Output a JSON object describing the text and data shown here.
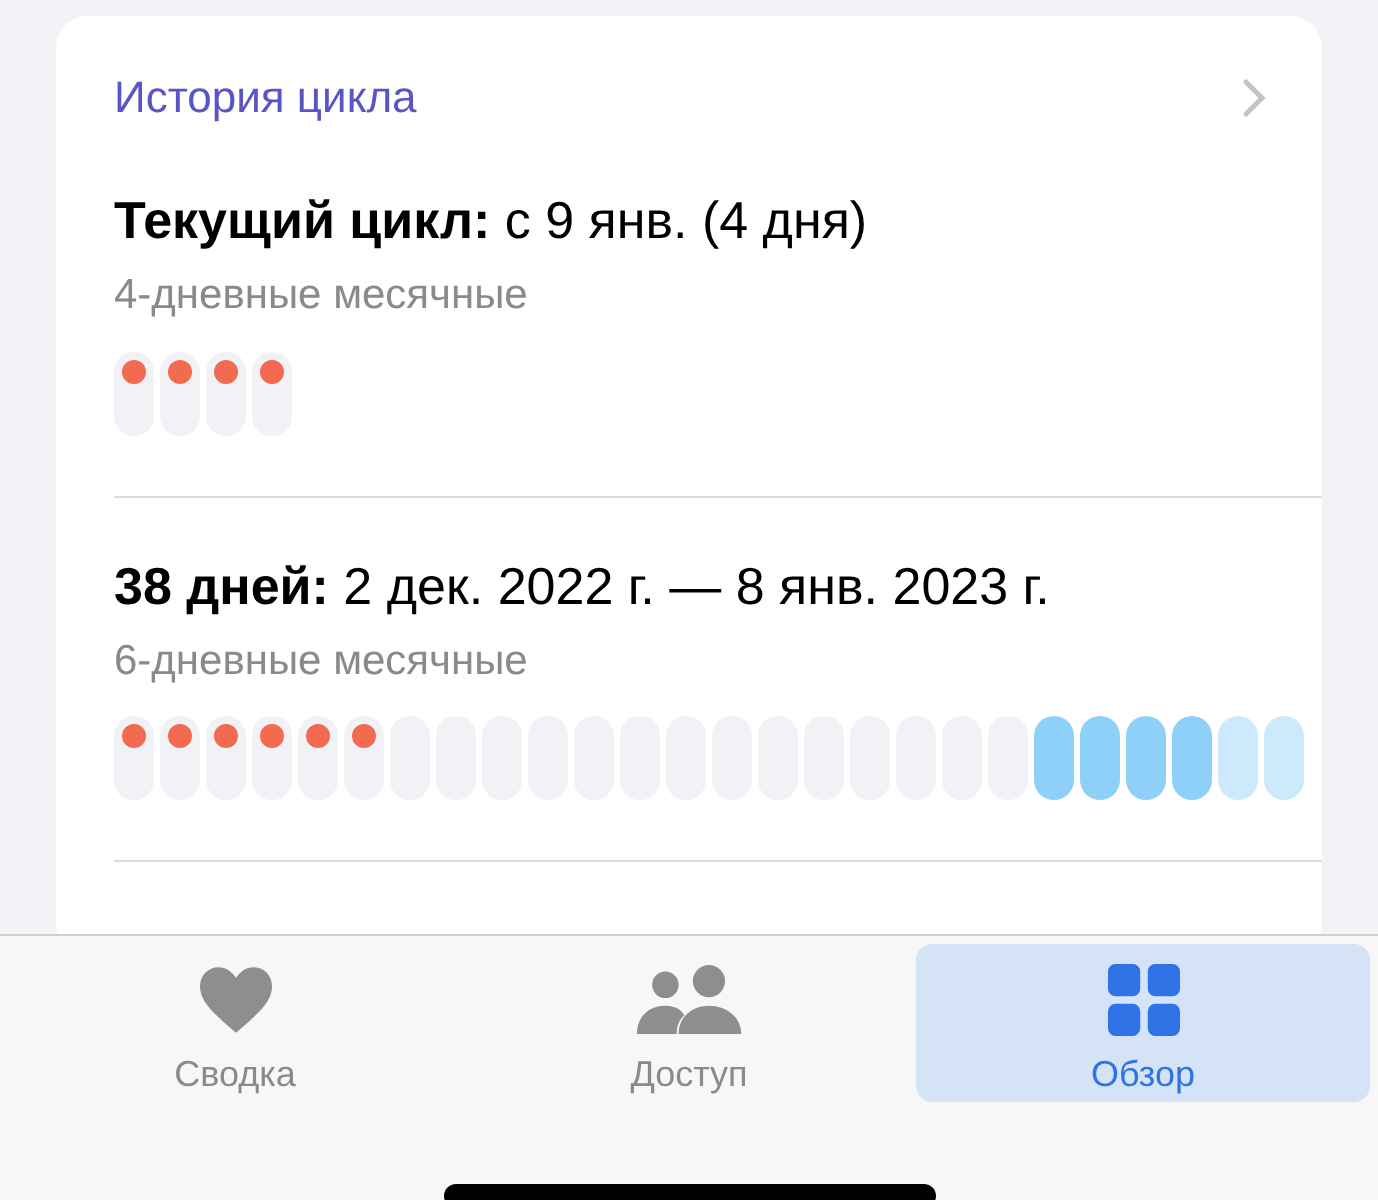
{
  "card": {
    "title": "История цикла",
    "cycles": [
      {
        "heading": "**Текущий цикл:** с 9 янв. (4 дня)",
        "subtitle": "4-дневные месячные",
        "days": [
          {
            "kind": "period"
          },
          {
            "kind": "period"
          },
          {
            "kind": "period"
          },
          {
            "kind": "period"
          }
        ]
      },
      {
        "heading": "**38 дней:** 2 дек. 2022 г. — 8 янв. 2023 г.",
        "subtitle": "6-дневные месячные",
        "days": [
          {
            "kind": "period"
          },
          {
            "kind": "period"
          },
          {
            "kind": "period"
          },
          {
            "kind": "period"
          },
          {
            "kind": "period"
          },
          {
            "kind": "period"
          },
          {
            "kind": "none"
          },
          {
            "kind": "none"
          },
          {
            "kind": "none"
          },
          {
            "kind": "none"
          },
          {
            "kind": "none"
          },
          {
            "kind": "none"
          },
          {
            "kind": "none"
          },
          {
            "kind": "none"
          },
          {
            "kind": "none"
          },
          {
            "kind": "none"
          },
          {
            "kind": "none"
          },
          {
            "kind": "none"
          },
          {
            "kind": "none"
          },
          {
            "kind": "none"
          },
          {
            "kind": "fertile"
          },
          {
            "kind": "fertile"
          },
          {
            "kind": "fertile"
          },
          {
            "kind": "fertile"
          },
          {
            "kind": "faded"
          },
          {
            "kind": "faded"
          }
        ]
      }
    ]
  },
  "tabs": [
    {
      "label": "Сводка",
      "selected": false
    },
    {
      "label": "Доступ",
      "selected": false
    },
    {
      "label": "Обзор",
      "selected": true
    }
  ]
}
